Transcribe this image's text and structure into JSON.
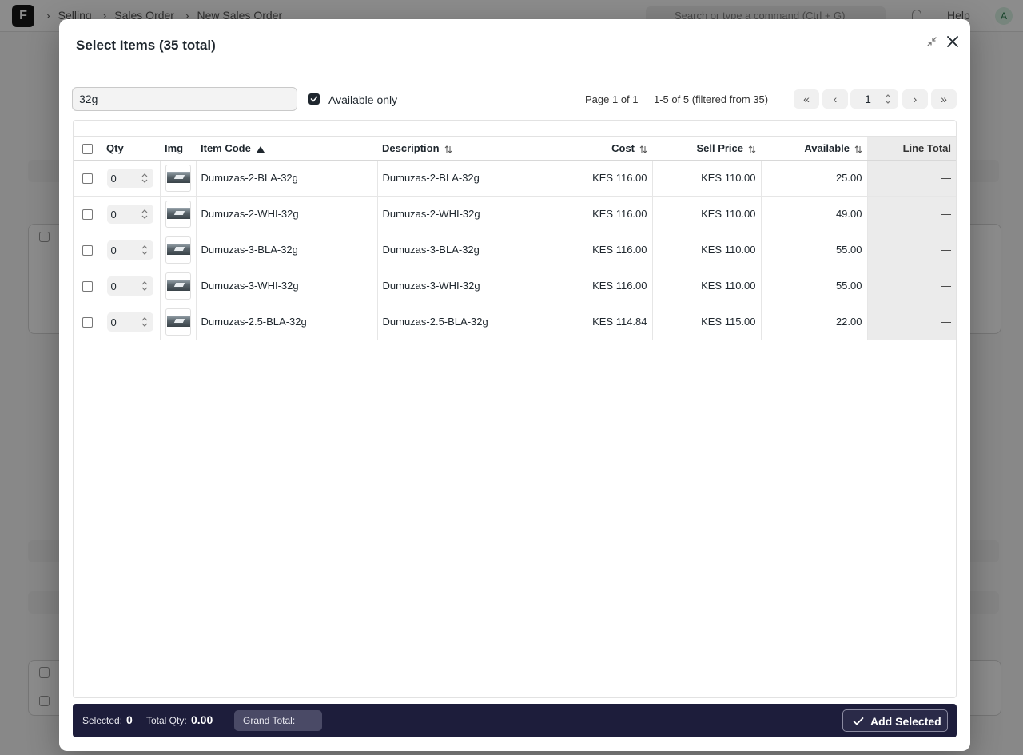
{
  "background": {
    "logo": "F",
    "breadcrumbs": [
      "Selling",
      "Sales Order",
      "New Sales Order"
    ],
    "search_placeholder": "Search or type a command (Ctrl + G)",
    "help_label": "Help",
    "avatar_initial": "A"
  },
  "modal": {
    "title": "Select Items (35 total)"
  },
  "toolbar": {
    "search_value": "32g",
    "available_only_label": "Available only",
    "available_only_checked": true,
    "page_info": "Page 1 of 1",
    "range_info": "1-5 of 5 (filtered from 35)",
    "first_label": "«",
    "prev_label": "‹",
    "page_number": "1",
    "next_label": "›",
    "last_label": "»"
  },
  "table": {
    "headers": {
      "qty": "Qty",
      "img": "Img",
      "item_code": "Item Code",
      "description": "Description",
      "cost": "Cost",
      "sell_price": "Sell Price",
      "available": "Available",
      "line_total": "Line Total"
    },
    "rows": [
      {
        "qty": "0",
        "item_code": "Dumuzas-2-BLA-32g",
        "description": "Dumuzas-2-BLA-32g",
        "cost": "KES 116.00",
        "sell_price": "KES 110.00",
        "available": "25.00",
        "line_total": "—"
      },
      {
        "qty": "0",
        "item_code": "Dumuzas-2-WHI-32g",
        "description": "Dumuzas-2-WHI-32g",
        "cost": "KES 116.00",
        "sell_price": "KES 110.00",
        "available": "49.00",
        "line_total": "—"
      },
      {
        "qty": "0",
        "item_code": "Dumuzas-3-BLA-32g",
        "description": "Dumuzas-3-BLA-32g",
        "cost": "KES 116.00",
        "sell_price": "KES 110.00",
        "available": "55.00",
        "line_total": "—"
      },
      {
        "qty": "0",
        "item_code": "Dumuzas-3-WHI-32g",
        "description": "Dumuzas-3-WHI-32g",
        "cost": "KES 116.00",
        "sell_price": "KES 110.00",
        "available": "55.00",
        "line_total": "—"
      },
      {
        "qty": "0",
        "item_code": "Dumuzas-2.5-BLA-32g",
        "description": "Dumuzas-2.5-BLA-32g",
        "cost": "KES 114.84",
        "sell_price": "KES 115.00",
        "available": "22.00",
        "line_total": "—"
      }
    ]
  },
  "footer": {
    "selected_label": "Selected:",
    "selected_value": "0",
    "total_qty_label": "Total Qty:",
    "total_qty_value": "0.00",
    "grand_total_label": "Grand Total:",
    "grand_total_value": "—",
    "add_selected_label": "Add Selected"
  },
  "colors": {
    "footer_bg": "#1d1d3b",
    "text": "#1f272e"
  }
}
